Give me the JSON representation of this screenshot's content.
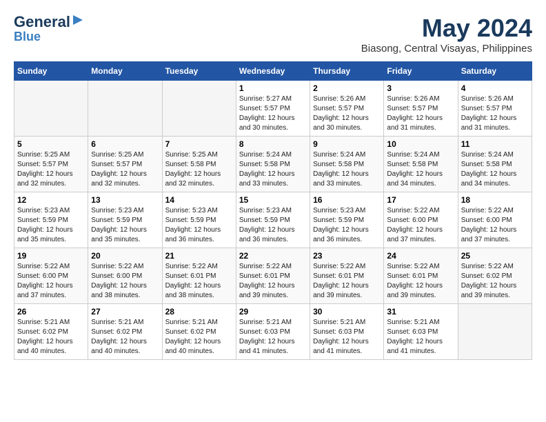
{
  "logo": {
    "general": "General",
    "blue": "Blue"
  },
  "title": "May 2024",
  "location": "Biasong, Central Visayas, Philippines",
  "weekdays": [
    "Sunday",
    "Monday",
    "Tuesday",
    "Wednesday",
    "Thursday",
    "Friday",
    "Saturday"
  ],
  "weeks": [
    [
      {
        "day": "",
        "info": ""
      },
      {
        "day": "",
        "info": ""
      },
      {
        "day": "",
        "info": ""
      },
      {
        "day": "1",
        "info": "Sunrise: 5:27 AM\nSunset: 5:57 PM\nDaylight: 12 hours and 30 minutes."
      },
      {
        "day": "2",
        "info": "Sunrise: 5:26 AM\nSunset: 5:57 PM\nDaylight: 12 hours and 30 minutes."
      },
      {
        "day": "3",
        "info": "Sunrise: 5:26 AM\nSunset: 5:57 PM\nDaylight: 12 hours and 31 minutes."
      },
      {
        "day": "4",
        "info": "Sunrise: 5:26 AM\nSunset: 5:57 PM\nDaylight: 12 hours and 31 minutes."
      }
    ],
    [
      {
        "day": "5",
        "info": "Sunrise: 5:25 AM\nSunset: 5:57 PM\nDaylight: 12 hours and 32 minutes."
      },
      {
        "day": "6",
        "info": "Sunrise: 5:25 AM\nSunset: 5:57 PM\nDaylight: 12 hours and 32 minutes."
      },
      {
        "day": "7",
        "info": "Sunrise: 5:25 AM\nSunset: 5:58 PM\nDaylight: 12 hours and 32 minutes."
      },
      {
        "day": "8",
        "info": "Sunrise: 5:24 AM\nSunset: 5:58 PM\nDaylight: 12 hours and 33 minutes."
      },
      {
        "day": "9",
        "info": "Sunrise: 5:24 AM\nSunset: 5:58 PM\nDaylight: 12 hours and 33 minutes."
      },
      {
        "day": "10",
        "info": "Sunrise: 5:24 AM\nSunset: 5:58 PM\nDaylight: 12 hours and 34 minutes."
      },
      {
        "day": "11",
        "info": "Sunrise: 5:24 AM\nSunset: 5:58 PM\nDaylight: 12 hours and 34 minutes."
      }
    ],
    [
      {
        "day": "12",
        "info": "Sunrise: 5:23 AM\nSunset: 5:59 PM\nDaylight: 12 hours and 35 minutes."
      },
      {
        "day": "13",
        "info": "Sunrise: 5:23 AM\nSunset: 5:59 PM\nDaylight: 12 hours and 35 minutes."
      },
      {
        "day": "14",
        "info": "Sunrise: 5:23 AM\nSunset: 5:59 PM\nDaylight: 12 hours and 36 minutes."
      },
      {
        "day": "15",
        "info": "Sunrise: 5:23 AM\nSunset: 5:59 PM\nDaylight: 12 hours and 36 minutes."
      },
      {
        "day": "16",
        "info": "Sunrise: 5:23 AM\nSunset: 5:59 PM\nDaylight: 12 hours and 36 minutes."
      },
      {
        "day": "17",
        "info": "Sunrise: 5:22 AM\nSunset: 6:00 PM\nDaylight: 12 hours and 37 minutes."
      },
      {
        "day": "18",
        "info": "Sunrise: 5:22 AM\nSunset: 6:00 PM\nDaylight: 12 hours and 37 minutes."
      }
    ],
    [
      {
        "day": "19",
        "info": "Sunrise: 5:22 AM\nSunset: 6:00 PM\nDaylight: 12 hours and 37 minutes."
      },
      {
        "day": "20",
        "info": "Sunrise: 5:22 AM\nSunset: 6:00 PM\nDaylight: 12 hours and 38 minutes."
      },
      {
        "day": "21",
        "info": "Sunrise: 5:22 AM\nSunset: 6:01 PM\nDaylight: 12 hours and 38 minutes."
      },
      {
        "day": "22",
        "info": "Sunrise: 5:22 AM\nSunset: 6:01 PM\nDaylight: 12 hours and 39 minutes."
      },
      {
        "day": "23",
        "info": "Sunrise: 5:22 AM\nSunset: 6:01 PM\nDaylight: 12 hours and 39 minutes."
      },
      {
        "day": "24",
        "info": "Sunrise: 5:22 AM\nSunset: 6:01 PM\nDaylight: 12 hours and 39 minutes."
      },
      {
        "day": "25",
        "info": "Sunrise: 5:22 AM\nSunset: 6:02 PM\nDaylight: 12 hours and 39 minutes."
      }
    ],
    [
      {
        "day": "26",
        "info": "Sunrise: 5:21 AM\nSunset: 6:02 PM\nDaylight: 12 hours and 40 minutes."
      },
      {
        "day": "27",
        "info": "Sunrise: 5:21 AM\nSunset: 6:02 PM\nDaylight: 12 hours and 40 minutes."
      },
      {
        "day": "28",
        "info": "Sunrise: 5:21 AM\nSunset: 6:02 PM\nDaylight: 12 hours and 40 minutes."
      },
      {
        "day": "29",
        "info": "Sunrise: 5:21 AM\nSunset: 6:03 PM\nDaylight: 12 hours and 41 minutes."
      },
      {
        "day": "30",
        "info": "Sunrise: 5:21 AM\nSunset: 6:03 PM\nDaylight: 12 hours and 41 minutes."
      },
      {
        "day": "31",
        "info": "Sunrise: 5:21 AM\nSunset: 6:03 PM\nDaylight: 12 hours and 41 minutes."
      },
      {
        "day": "",
        "info": ""
      }
    ]
  ]
}
